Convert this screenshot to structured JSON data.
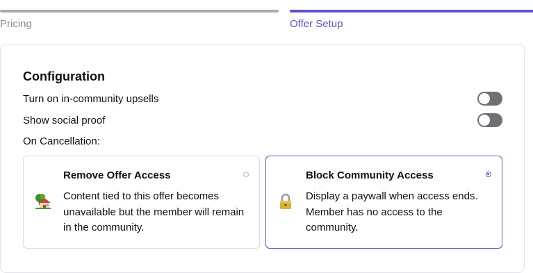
{
  "steps": [
    {
      "label": "Pricing",
      "state": "complete"
    },
    {
      "label": "Offer Setup",
      "state": "active"
    }
  ],
  "colors": {
    "accent": "#5a54c7",
    "inactive_step": "#a8a8b3",
    "toggle_off": "#6f6f76"
  },
  "configuration": {
    "title": "Configuration",
    "toggles": [
      {
        "label": "Turn on in-community upsells",
        "on": false
      },
      {
        "label": "Show social proof",
        "on": false
      }
    ],
    "cancellation_label": "On Cancellation:",
    "options": [
      {
        "title": "Remove Offer Access",
        "description": "Content tied to this offer becomes unavailable but the member will remain in the community.",
        "icon": "house-with-garden-icon",
        "selected": false
      },
      {
        "title": "Block Community Access",
        "description": "Display a paywall when access ends. Member has no access to the community.",
        "icon": "lock-icon",
        "selected": true
      }
    ]
  }
}
